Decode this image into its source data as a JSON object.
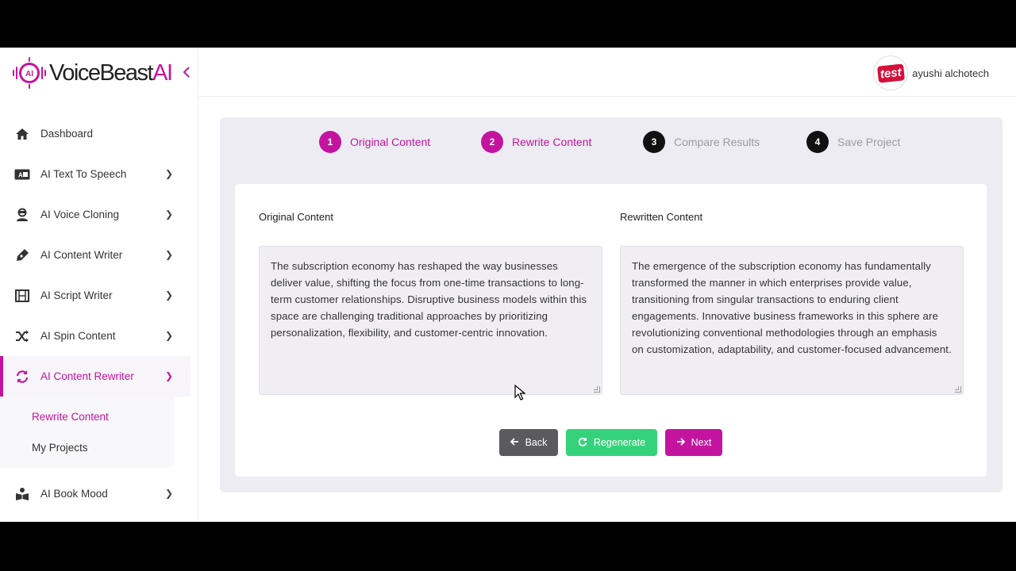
{
  "brand": {
    "name": "VoiceBeast",
    "suffix": "AI",
    "logo_text": "AI"
  },
  "header": {
    "user_name": "ayushi alchotech",
    "avatar_text": "test"
  },
  "sidebar": {
    "items": [
      {
        "label": "Dashboard",
        "icon": "home-icon"
      },
      {
        "label": "AI Text To Speech",
        "icon": "text-speech-icon"
      },
      {
        "label": "AI Voice Cloning",
        "icon": "user-clone-icon"
      },
      {
        "label": "AI Content Writer",
        "icon": "pen-icon"
      },
      {
        "label": "AI Script Writer",
        "icon": "film-icon"
      },
      {
        "label": "AI Spin Content",
        "icon": "shuffle-icon"
      },
      {
        "label": "AI Content Rewriter",
        "icon": "sync-icon"
      },
      {
        "label": "AI Book Mood",
        "icon": "book-reader-icon"
      }
    ],
    "sub_items": [
      {
        "label": "Rewrite Content"
      },
      {
        "label": "My Projects"
      }
    ]
  },
  "steps": [
    {
      "num": "1",
      "label": "Original Content",
      "state": "done"
    },
    {
      "num": "2",
      "label": "Rewrite Content",
      "state": "done"
    },
    {
      "num": "3",
      "label": "Compare Results",
      "state": "todo"
    },
    {
      "num": "4",
      "label": "Save Project",
      "state": "todo"
    }
  ],
  "content": {
    "original_label": "Original Content",
    "original_text": "The subscription economy has reshaped the way businesses deliver value, shifting the focus from one-time transactions to long-term customer relationships. Disruptive business models within this space are challenging traditional approaches by prioritizing personalization, flexibility, and customer-centric innovation.",
    "rewritten_label": "Rewritten Content",
    "rewritten_text": "The emergence of the subscription economy has fundamentally transformed the manner in which enterprises provide value, transitioning from singular transactions to enduring client engagements. Innovative business frameworks in this sphere are revolutionizing conventional methodologies through an emphasis on customization, adaptability, and customer-focused advancement."
  },
  "buttons": {
    "back": "Back",
    "regenerate": "Regenerate",
    "next": "Next"
  },
  "colors": {
    "accent": "#c4149f",
    "success": "#35d27c",
    "neutral": "#5a5a5f"
  }
}
